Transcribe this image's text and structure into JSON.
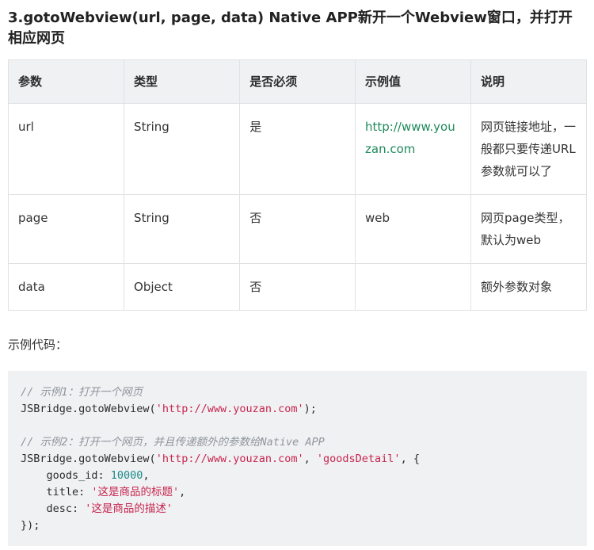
{
  "heading": "3.gotoWebview(url, page, data) Native APP新开一个Webview窗口，并打开相应网页",
  "table": {
    "headers": [
      "参数",
      "类型",
      "是否必须",
      "示例值",
      "说明"
    ],
    "rows": [
      [
        "url",
        "String",
        "是",
        "http://www.youzan.com",
        "网页链接地址，一般都只要传递URL参数就可以了"
      ],
      [
        "page",
        "String",
        "否",
        "web",
        "网页page类型，默认为web"
      ],
      [
        "data",
        "Object",
        "否",
        "",
        "额外参数对象"
      ]
    ]
  },
  "caption": "示例代码：",
  "code": {
    "comment1": "// 示例1：打开一个网页",
    "line1_pre": "JSBridge.gotoWebview(",
    "line1_url": "'http://www.youzan.com'",
    "line1_post": ");",
    "comment2": "// 示例2：打开一个网页，并且传递额外的参数给Native APP",
    "line2_pre": "JSBridge.gotoWebview(",
    "line2_url": "'http://www.youzan.com'",
    "line2_mid": ", ",
    "line2_page": "'goodsDetail'",
    "line2_post": ", {",
    "goods_id_key": "    goods_id: ",
    "goods_id_val": "10000",
    "goods_id_post": ",",
    "title_key": "    title: ",
    "title_val": "'这是商品的标题'",
    "title_post": ",",
    "desc_key": "    desc: ",
    "desc_val": "'这是商品的描述'",
    "close": "});"
  },
  "colors": {
    "link": "#1f8a5c",
    "string": "#c7254e",
    "number": "#1b8a8a",
    "comment": "#8e959c",
    "header_bg": "#f0f1f3",
    "code_bg": "#f0f1f3"
  }
}
